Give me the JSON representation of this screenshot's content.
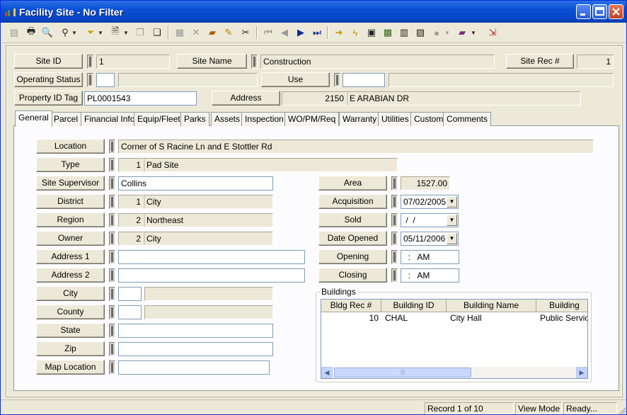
{
  "window": {
    "title": "Facility Site - No Filter"
  },
  "header": {
    "site_id_label": "Site ID",
    "site_id": "1",
    "site_name_label": "Site Name",
    "site_name": "Construction",
    "site_rec_label": "Site Rec #",
    "site_rec": "1",
    "operating_status_label": "Operating Status",
    "operating_status_code": "",
    "operating_status_desc": "",
    "use_label": "Use",
    "use_code": "",
    "use_desc": "",
    "property_id_label": "Property ID Tag",
    "property_id": "PL0001543",
    "address_label": "Address",
    "address_num": "2150",
    "address_street": "E ARABIAN DR"
  },
  "tabs": [
    "General",
    "Parcel",
    "Financial Info",
    "Equip/Fleet",
    "Parks",
    "Assets",
    "Inspection",
    "WO/PM/Req",
    "Warranty",
    "Utilities",
    "Custom",
    "Comments"
  ],
  "general": {
    "location_label": "Location",
    "location": "Corner of S Racine Ln and E Stottler Rd",
    "type_label": "Type",
    "type_code": "1",
    "type_desc": "Pad Site",
    "supervisor_label": "Site Supervisor",
    "supervisor": "Collins",
    "district_label": "District",
    "district_code": "1",
    "district_desc": "City",
    "region_label": "Region",
    "region_code": "2",
    "region_desc": "Northeast",
    "owner_label": "Owner",
    "owner_code": "2",
    "owner_desc": "City",
    "address1_label": "Address 1",
    "address1": "",
    "address2_label": "Address 2",
    "address2": "",
    "city_label": "City",
    "city_code": "",
    "city_desc": "",
    "county_label": "County",
    "county_code": "",
    "county_desc": "",
    "state_label": "State",
    "state": "",
    "zip_label": "Zip",
    "zip": "",
    "map_label": "Map Location",
    "map": "",
    "area_label": "Area",
    "area": "1527.00",
    "acquisition_label": "Acquisition",
    "acquisition": "07/02/2005",
    "sold_label": "Sold",
    "sold": " /  /",
    "opened_label": "Date Opened",
    "opened": "05/11/2006",
    "opening_label": "Opening",
    "opening": "  :   AM",
    "closing_label": "Closing",
    "closing": "  :   AM"
  },
  "buildings": {
    "title": "Buildings",
    "columns": [
      "Bldg Rec #",
      "Building ID",
      "Building Name",
      "Building"
    ],
    "rows": [
      {
        "rec": "10",
        "id": "CHAL",
        "name": "City Hall",
        "type": "Public Service"
      }
    ]
  },
  "status": {
    "record": "Record 1 of 10",
    "mode": "View Mode",
    "state": "Ready..."
  }
}
